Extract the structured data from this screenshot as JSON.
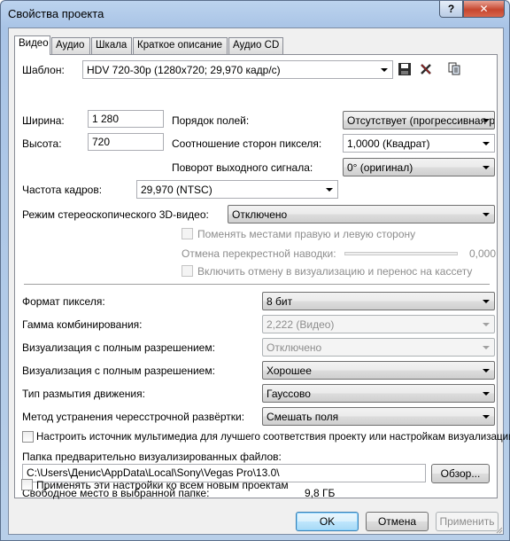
{
  "window": {
    "title": "Свойства проекта",
    "help_label": "?",
    "close_label": "✕"
  },
  "tabs": [
    "Видео",
    "Аудио",
    "Шкала",
    "Краткое описание",
    "Аудио CD"
  ],
  "template": {
    "label": "Шаблон:",
    "value": "HDV 720-30p (1280x720; 29,970 кадр/с)"
  },
  "width": {
    "label": "Ширина:",
    "value": "1 280"
  },
  "height": {
    "label": "Высота:",
    "value": "720"
  },
  "field_order": {
    "label": "Порядок полей:",
    "value": "Отсутствует (прогрессивная р"
  },
  "pixel_aspect": {
    "label": "Соотношение сторон пикселя:",
    "value": "1,0000 (Квадрат)"
  },
  "output_rotation": {
    "label": "Поворот выходного сигнала:",
    "value": "0° (оригинал)"
  },
  "frame_rate": {
    "label": "Частота кадров:",
    "value": "29,970 (NTSC)"
  },
  "stereo3d": {
    "label": "Режим стереоскопического 3D-видео:",
    "value": "Отключено",
    "swap_label": "Поменять местами правую и левую сторону",
    "crosstalk_label": "Отмена перекрестной наводки:",
    "crosstalk_value": "0,000",
    "render_label": "Включить отмену в визуализацию и перенос на кассету"
  },
  "pixel_format": {
    "label": "Формат пикселя:",
    "value": "8 бит"
  },
  "gamma": {
    "label": "Гамма комбинирования:",
    "value": "2,222 (Видео)"
  },
  "full_res_1": {
    "label": "Визуализация с полным разрешением:",
    "value": "Отключено"
  },
  "full_res_2": {
    "label": "Визуализация с полным разрешением:",
    "value": "Хорошее"
  },
  "motion_blur": {
    "label": "Тип размытия движения:",
    "value": "Гауссово"
  },
  "deinterlace": {
    "label": "Метод устранения чересстрочной развёртки:",
    "value": "Смешать поля"
  },
  "adapt_media_label": "Настроить источник мультимедиа для лучшего соответствия проекту или настройкам визуализации",
  "prerender": {
    "label": "Папка предварительно визуализированных файлов:",
    "path": "C:\\Users\\Денис\\AppData\\Local\\Sony\\Vegas Pro\\13.0\\",
    "browse_label": "Обзор...",
    "free_space_label": "Свободное место в выбранной папке:",
    "free_space_value": "9,8 ГБ"
  },
  "apply_all_label": "Применять эти настройки ко всем новым проектам",
  "buttons": {
    "ok": "OK",
    "cancel": "Отмена",
    "apply": "Применить"
  },
  "colors": {
    "accent": "#3c7fb1",
    "close": "#c6472f",
    "disabled_text": "#8d8d8d"
  }
}
